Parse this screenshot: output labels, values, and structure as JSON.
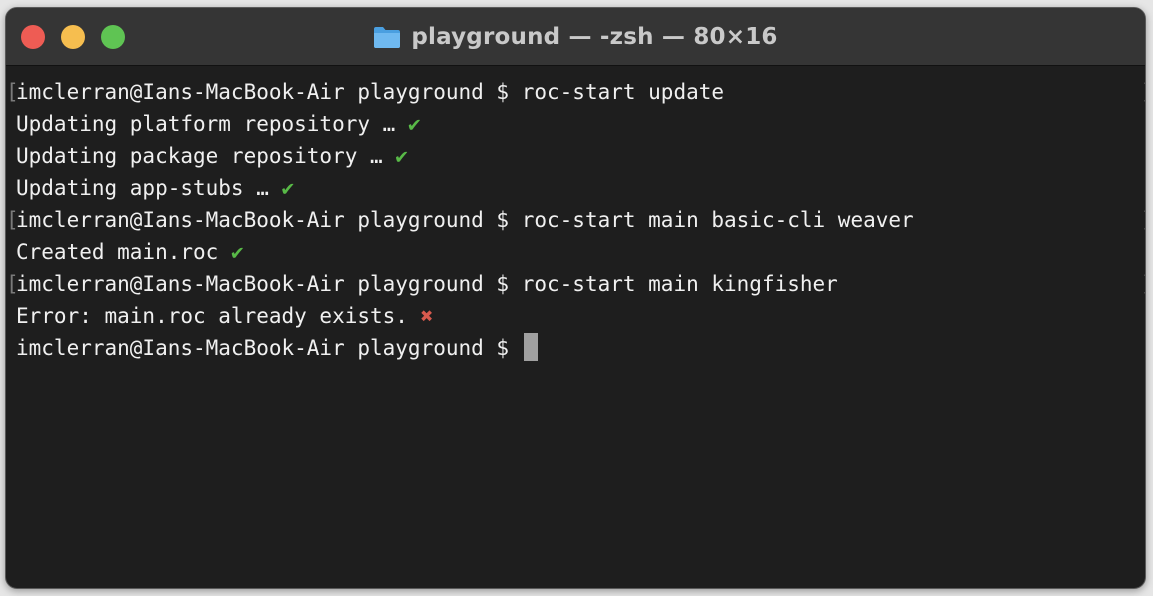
{
  "window": {
    "title": "playground — -zsh — 80×16",
    "folder_icon": "folder-icon",
    "colors": {
      "close": "#ee5c54",
      "minimize": "#f6be4f",
      "zoom": "#5fc453",
      "background": "#1e1e1e",
      "success": "#58b947",
      "error": "#d85a4e"
    }
  },
  "terminal": {
    "lines": [
      {
        "kind": "prompt",
        "prompt": "imclerran@Ians-MacBook-Air playground $ ",
        "command": "roc-start update"
      },
      {
        "kind": "output",
        "text": "Updating platform repository … ",
        "status": "✔"
      },
      {
        "kind": "output",
        "text": "Updating package repository … ",
        "status": "✔"
      },
      {
        "kind": "output",
        "text": "Updating app-stubs … ",
        "status": "✔"
      },
      {
        "kind": "prompt",
        "prompt": "imclerran@Ians-MacBook-Air playground $ ",
        "command": "roc-start main basic-cli weaver"
      },
      {
        "kind": "output",
        "text": "Created main.roc ",
        "status": "✔"
      },
      {
        "kind": "prompt",
        "prompt": "imclerran@Ians-MacBook-Air playground $ ",
        "command": "roc-start main kingfisher"
      },
      {
        "kind": "output",
        "text": "Error: main.roc already exists. ",
        "status": "✖"
      },
      {
        "kind": "current",
        "prompt": "imclerran@Ians-MacBook-Air playground $ ",
        "command": ""
      }
    ],
    "bracket_open": "[",
    "bracket_close": "]"
  }
}
